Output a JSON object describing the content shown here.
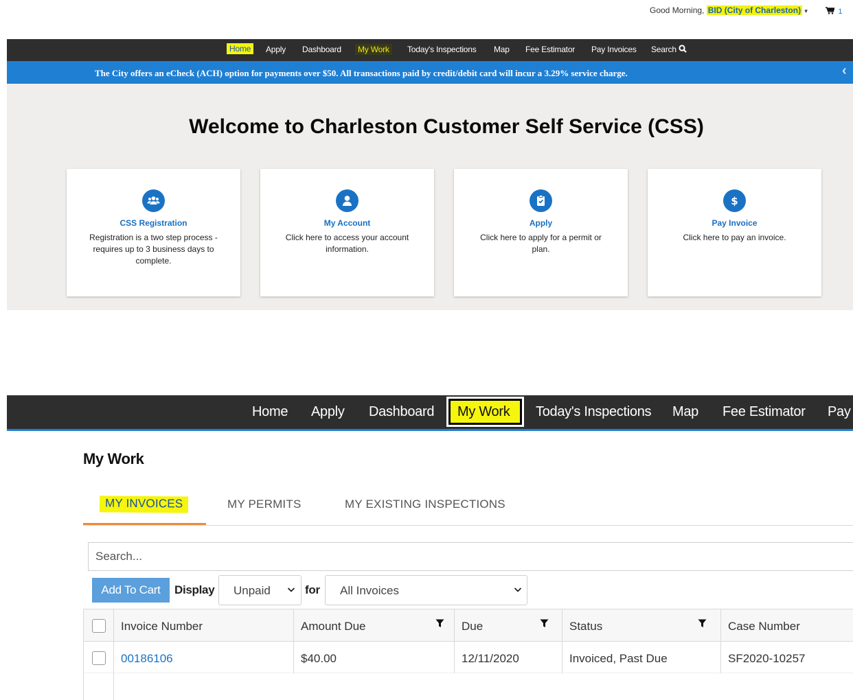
{
  "header": {
    "greeting": "Good Morning,",
    "user": "BID (City of Charleston)",
    "caret": "▾",
    "cart_count": "1"
  },
  "nav_small": {
    "items": [
      "Home",
      "Apply",
      "Dashboard",
      "My Work",
      "Today's Inspections",
      "Map",
      "Fee Estimator",
      "Pay Invoices",
      "Search"
    ]
  },
  "announcement": {
    "text": "The City offers an eCheck (ACH) option for payments over $50. All transactions paid by credit/debit card will incur a 3.29% service charge.",
    "icon": "chevron-left-icon"
  },
  "hero": {
    "title": "Welcome to Charleston Customer Self Service (CSS)",
    "cards": [
      {
        "title": "CSS Registration",
        "desc": "Registration is a two step process - requires up to 3 business days to complete.",
        "icon": "users-icon"
      },
      {
        "title": "My Account",
        "desc": "Click here to access your account information.",
        "icon": "user-icon"
      },
      {
        "title": "Apply",
        "desc": "Click here to apply for a permit or plan.",
        "icon": "clipboard-check-icon"
      },
      {
        "title": "Pay Invoice",
        "desc": "Click here to pay an invoice.",
        "icon": "dollar-icon"
      }
    ]
  },
  "nav_large": {
    "items": [
      "Home",
      "Apply",
      "Dashboard",
      "My Work",
      "Today's Inspections",
      "Map",
      "Fee Estimator",
      "Pay"
    ]
  },
  "mywork": {
    "title": "My Work",
    "tabs": [
      "MY INVOICES",
      "MY PERMITS",
      "MY EXISTING INSPECTIONS"
    ],
    "search_placeholder": "Search...",
    "add_to_cart": "Add To Cart",
    "display_label": "Display",
    "display_value": "Unpaid",
    "for_label": "for",
    "for_value": "All Invoices"
  },
  "table": {
    "columns": [
      "Invoice Number",
      "Amount Due",
      "Due",
      "Status",
      "Case Number"
    ],
    "rows": [
      {
        "invoice": "00186106",
        "amount": "$40.00",
        "due": "12/11/2020",
        "status": "Invoiced, Past Due",
        "case": "SF2020-10257"
      }
    ]
  },
  "colors": {
    "nav_bg": "#2e2e2e",
    "accent_blue": "#1f7fd3",
    "highlight_yellow": "#f5f50d",
    "link_blue": "#1a72c4",
    "tab_underline": "#f08a3a"
  }
}
